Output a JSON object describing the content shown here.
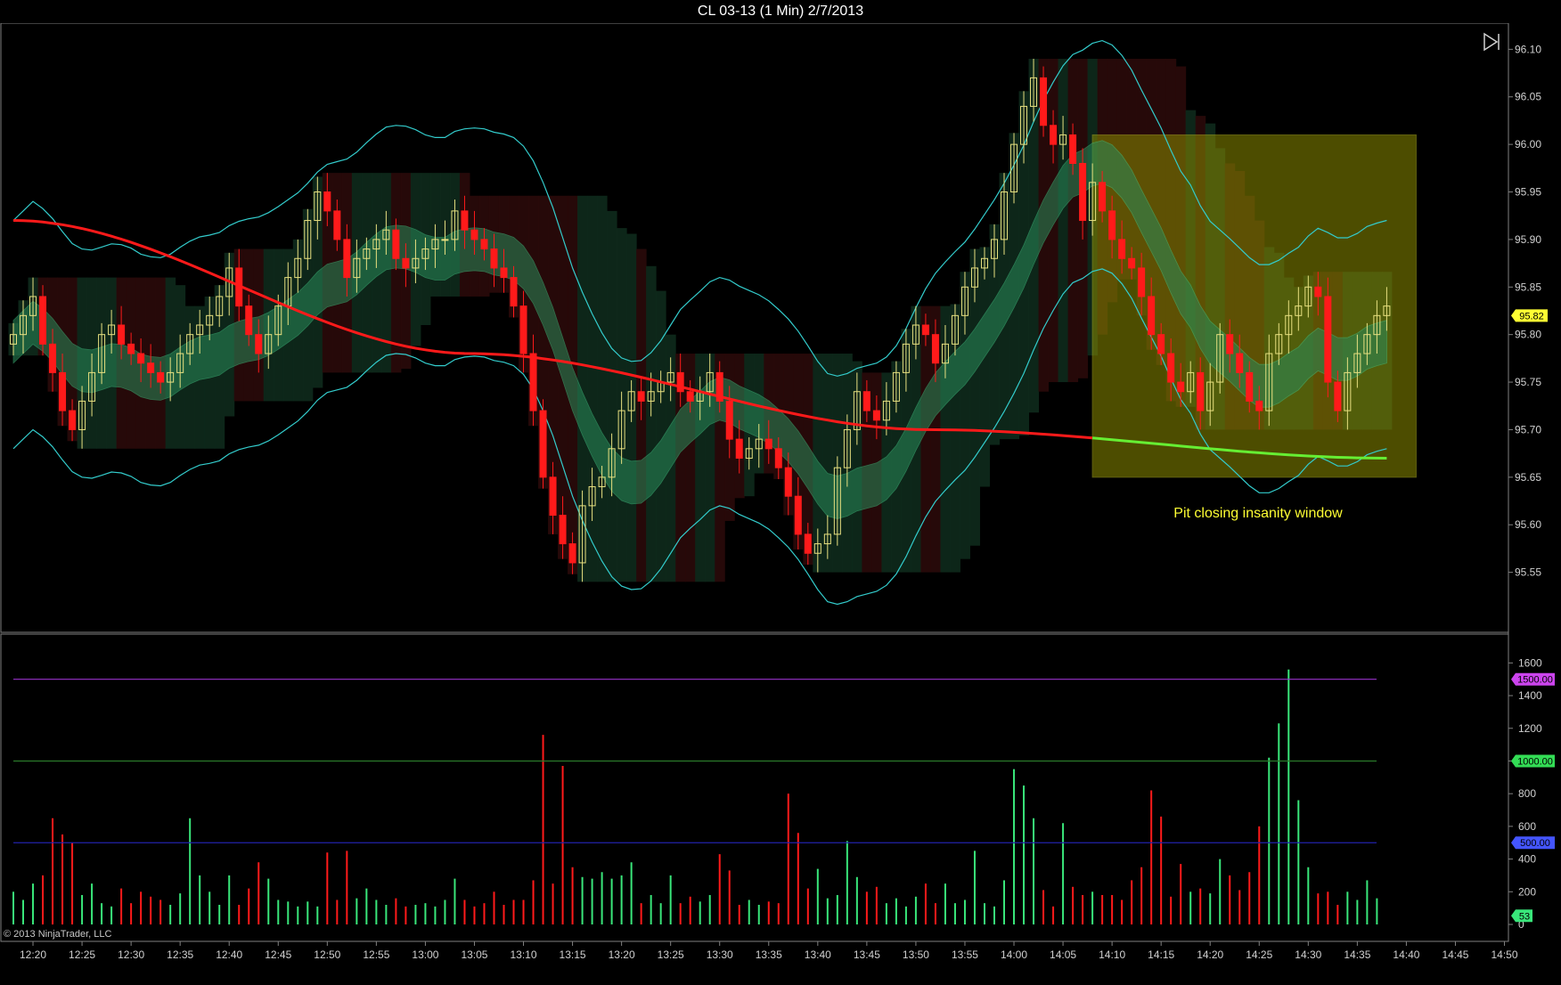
{
  "window": {
    "title": "CL 03-13 (1 Min)  2/7/2013",
    "copyright": "© 2013 NinjaTrader, LLC"
  },
  "colors": {
    "up": "#39e67a",
    "down": "#ff1a1a",
    "hollow_up": "#e8e080",
    "envelope": "#33cccc",
    "ema_red": "#ff1a1a",
    "ema_green": "#66ee33",
    "highlight": "#8c8c00",
    "annotation": "#ffff33",
    "line_1500": "#9933cc",
    "line_1000": "#2a7a2a",
    "line_500": "#2222aa",
    "grid_border": "#808080"
  },
  "chart_data": [
    {
      "type": "candlestick",
      "title": "CL 03-13 (1 Min)  2/7/2013",
      "ylim": [
        95.5,
        96.12
      ],
      "y_ticks": [
        "96.10",
        "96.05",
        "96.00",
        "95.95",
        "95.90",
        "95.85",
        "95.80",
        "95.75",
        "95.70",
        "95.65",
        "95.60",
        "95.55"
      ],
      "x_ticks": [
        "12:20",
        "12:25",
        "12:30",
        "12:35",
        "12:40",
        "12:45",
        "12:50",
        "12:55",
        "13:00",
        "13:05",
        "13:10",
        "13:15",
        "13:20",
        "13:25",
        "13:30",
        "13:35",
        "13:40",
        "13:45",
        "13:50",
        "13:55",
        "14:00",
        "14:05",
        "14:10",
        "14:15",
        "14:20",
        "14:25",
        "14:30",
        "14:35",
        "14:40",
        "14:45",
        "14:50"
      ],
      "last_price": "95.82",
      "annotation": "Pit closing insanity window",
      "highlight_window": {
        "from": "14:08",
        "to": "14:41",
        "price_high": 96.01,
        "price_low": 95.65
      },
      "series": [
        {
          "name": "Close",
          "values": [
            95.8,
            95.82,
            95.84,
            95.79,
            95.76,
            95.72,
            95.7,
            95.73,
            95.76,
            95.8,
            95.81,
            95.79,
            95.78,
            95.77,
            95.76,
            95.75,
            95.76,
            95.78,
            95.8,
            95.81,
            95.82,
            95.84,
            95.87,
            95.83,
            95.8,
            95.78,
            95.8,
            95.83,
            95.86,
            95.88,
            95.92,
            95.95,
            95.93,
            95.9,
            95.86,
            95.88,
            95.89,
            95.9,
            95.91,
            95.88,
            95.87,
            95.88,
            95.89,
            95.9,
            95.9,
            95.93,
            95.91,
            95.9,
            95.89,
            95.87,
            95.86,
            95.83,
            95.78,
            95.72,
            95.65,
            95.61,
            95.58,
            95.56,
            95.62,
            95.64,
            95.65,
            95.68,
            95.72,
            95.74,
            95.73,
            95.74,
            95.75,
            95.76,
            95.74,
            95.73,
            95.74,
            95.76,
            95.73,
            95.69,
            95.67,
            95.68,
            95.69,
            95.68,
            95.66,
            95.63,
            95.59,
            95.57,
            95.58,
            95.59,
            95.66,
            95.7,
            95.74,
            95.72,
            95.71,
            95.73,
            95.76,
            95.79,
            95.81,
            95.8,
            95.77,
            95.79,
            95.82,
            95.85,
            95.87,
            95.88,
            95.9,
            95.95,
            96.0,
            96.04,
            96.07,
            96.02,
            96.0,
            96.01,
            95.98,
            95.92,
            95.96,
            95.93,
            95.9,
            95.88,
            95.87,
            95.84,
            95.8,
            95.78,
            95.75,
            95.74,
            95.76,
            95.72,
            95.75,
            95.8,
            95.78,
            95.76,
            95.73,
            95.72,
            95.78,
            95.8,
            95.82,
            95.83,
            95.85,
            95.84,
            95.75,
            95.72,
            95.76,
            95.78,
            95.8,
            95.82,
            95.83
          ]
        },
        {
          "name": "EMA",
          "values": [
            95.92,
            95.78,
            95.7,
            95.67
          ]
        },
        {
          "name": "Volume",
          "values": [
            200,
            150,
            250,
            300,
            650,
            550,
            500,
            180,
            250,
            130,
            110,
            220,
            130,
            200,
            170,
            150,
            120,
            190,
            650,
            300,
            200,
            120,
            300,
            120,
            220,
            380,
            280,
            150,
            140,
            110,
            140,
            110,
            440,
            150,
            450,
            160,
            220,
            150,
            120,
            160,
            110,
            120,
            130,
            110,
            150,
            280,
            150,
            110,
            130,
            200,
            120,
            150,
            150,
            270,
            1160,
            250,
            970,
            350,
            290,
            280,
            320,
            280,
            300,
            380,
            130,
            180,
            130,
            300,
            130,
            170,
            140,
            180,
            430,
            330,
            120,
            150,
            120,
            140,
            130,
            800,
            560,
            220,
            340,
            160,
            180,
            510,
            290,
            200,
            230,
            130,
            160,
            110,
            170,
            250,
            130,
            250,
            130,
            150,
            450,
            130,
            110,
            270,
            950,
            850,
            650,
            210,
            110,
            620,
            230,
            180,
            200,
            180,
            180,
            150,
            270,
            350,
            820,
            660,
            170,
            370,
            200,
            220,
            190,
            400,
            300,
            210,
            320,
            600,
            1020,
            1230,
            1560,
            760,
            350,
            190,
            200,
            120,
            200,
            150,
            270,
            160
          ]
        }
      ],
      "volume_levels": [
        "1500.00",
        "1000.00",
        "500.00"
      ],
      "volume_ticks": [
        "1600",
        "1400",
        "1200",
        "1000",
        "800",
        "600",
        "400",
        "200",
        "0"
      ],
      "last_volume": "53"
    }
  ]
}
